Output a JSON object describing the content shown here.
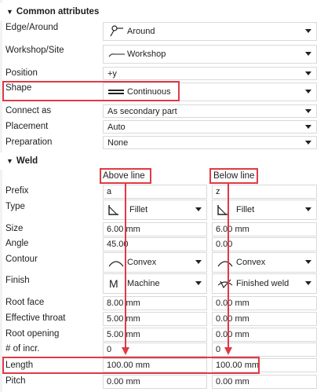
{
  "common": {
    "header": "Common attributes",
    "edge_around": {
      "label": "Edge/Around",
      "value": "Around",
      "icon": "flag-pin-icon"
    },
    "workshop_site": {
      "label": "Workshop/Site",
      "value": "Workshop",
      "icon": "line-icon"
    },
    "position": {
      "label": "Position",
      "value": "+y"
    },
    "shape": {
      "label": "Shape",
      "value": "Continuous",
      "icon": "double-line-icon"
    },
    "connect_as": {
      "label": "Connect as",
      "value": "As secondary part"
    },
    "placement": {
      "label": "Placement",
      "value": "Auto"
    },
    "preparation": {
      "label": "Preparation",
      "value": "None"
    }
  },
  "weld": {
    "header": "Weld",
    "above_label": "Above line",
    "below_label": "Below line",
    "rows": {
      "prefix": {
        "label": "Prefix",
        "above": "a",
        "below": "z"
      },
      "type": {
        "label": "Type",
        "above": "Fillet",
        "below": "Fillet"
      },
      "size": {
        "label": "Size",
        "above": "6.00 mm",
        "below": "6.00 mm"
      },
      "angle": {
        "label": "Angle",
        "above": "45.00",
        "below": "0.00"
      },
      "contour": {
        "label": "Contour",
        "above": "Convex",
        "below": "Convex"
      },
      "finish": {
        "label": "Finish",
        "above": "Machine",
        "below": "Finished weld",
        "above_icon_glyph": "M"
      },
      "root_face": {
        "label": "Root face",
        "above": "8.00 mm",
        "below": "0.00 mm"
      },
      "effective_throat": {
        "label": "Effective throat",
        "above": "5.00 mm",
        "below": "0.00 mm"
      },
      "root_opening": {
        "label": "Root opening",
        "above": "5.00 mm",
        "below": "0.00 mm"
      },
      "num_incr": {
        "label": "# of incr.",
        "above": "0",
        "below": "0"
      },
      "length": {
        "label": "Length",
        "above": "100.00 mm",
        "below": "100.00 mm"
      },
      "pitch": {
        "label": "Pitch",
        "above": "0.00 mm",
        "below": "0.00 mm"
      }
    }
  },
  "colors": {
    "highlight": "#e03a45",
    "border": "#d9d9d9",
    "text": "#1e1e1e"
  }
}
